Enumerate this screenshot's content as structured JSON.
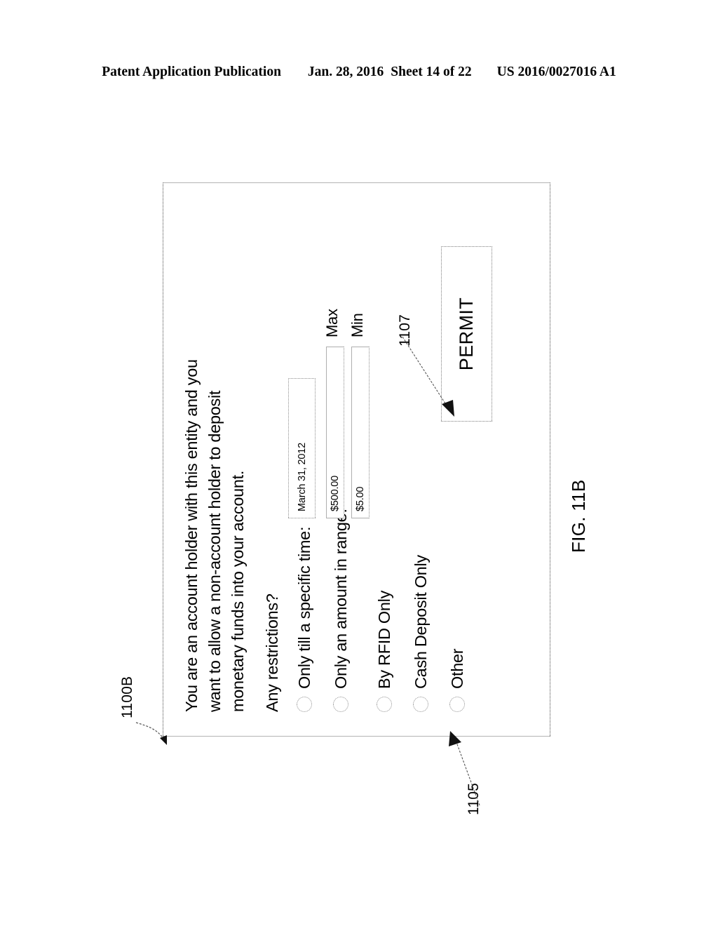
{
  "header": {
    "publication": "Patent Application Publication",
    "date": "Jan. 28, 2016",
    "sheet": "Sheet 14 of 22",
    "patent_number": "US 2016/0027016 A1"
  },
  "figure": {
    "caption": "FIG. 11B",
    "reference_numerals": {
      "dialog": "1100B",
      "options_group": "1105",
      "permit_button": "1107"
    }
  },
  "dialog": {
    "intro_lines": [
      "You are an account holder with this entity and you",
      "want to allow a non-account holder to deposit",
      "monetary funds into your account."
    ],
    "question": "Any restrictions?",
    "options": [
      {
        "label": "Only till a specific time:",
        "selected": false
      },
      {
        "label": "Only an amount in range:",
        "selected": false
      },
      {
        "label": "By RFID Only",
        "selected": false
      },
      {
        "label": "Cash Deposit Only",
        "selected": false
      },
      {
        "label": "Other",
        "selected": false
      }
    ],
    "fields": {
      "date": {
        "value": "March 31, 2012"
      },
      "max": {
        "value": "$500.00",
        "label": "Max"
      },
      "min": {
        "value": "$5.00",
        "label": "Min"
      }
    },
    "permit_button_label": "PERMIT"
  }
}
